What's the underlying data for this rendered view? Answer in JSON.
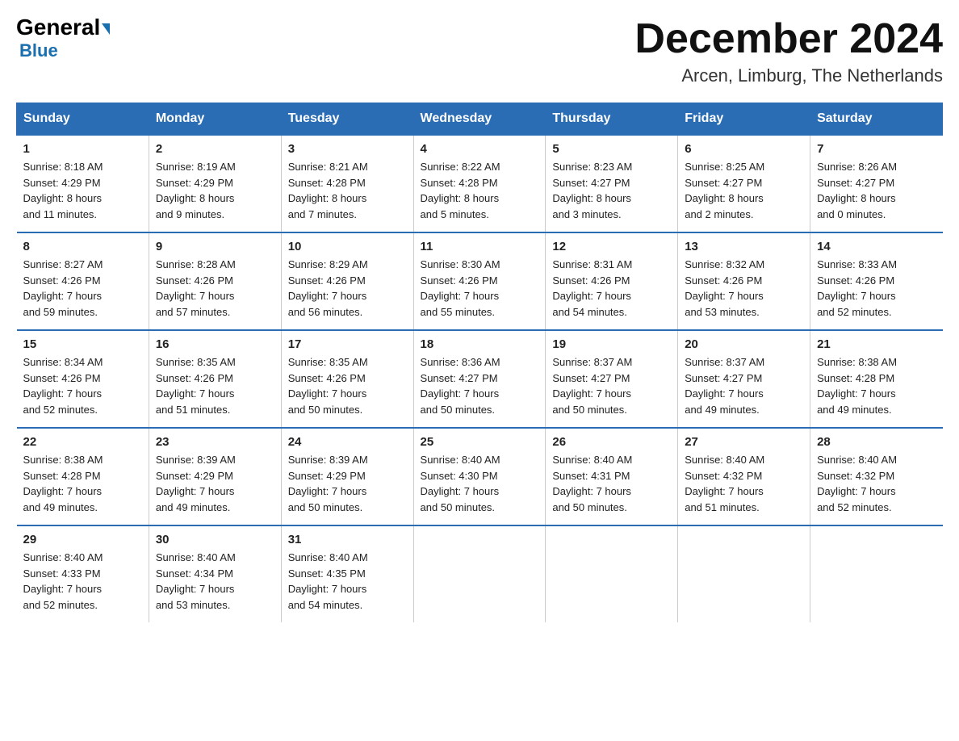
{
  "header": {
    "logo_line1": "General",
    "logo_line2": "Blue",
    "month_year": "December 2024",
    "location": "Arcen, Limburg, The Netherlands"
  },
  "days_of_week": [
    "Sunday",
    "Monday",
    "Tuesday",
    "Wednesday",
    "Thursday",
    "Friday",
    "Saturday"
  ],
  "weeks": [
    [
      {
        "num": "1",
        "info": "Sunrise: 8:18 AM\nSunset: 4:29 PM\nDaylight: 8 hours\nand 11 minutes."
      },
      {
        "num": "2",
        "info": "Sunrise: 8:19 AM\nSunset: 4:29 PM\nDaylight: 8 hours\nand 9 minutes."
      },
      {
        "num": "3",
        "info": "Sunrise: 8:21 AM\nSunset: 4:28 PM\nDaylight: 8 hours\nand 7 minutes."
      },
      {
        "num": "4",
        "info": "Sunrise: 8:22 AM\nSunset: 4:28 PM\nDaylight: 8 hours\nand 5 minutes."
      },
      {
        "num": "5",
        "info": "Sunrise: 8:23 AM\nSunset: 4:27 PM\nDaylight: 8 hours\nand 3 minutes."
      },
      {
        "num": "6",
        "info": "Sunrise: 8:25 AM\nSunset: 4:27 PM\nDaylight: 8 hours\nand 2 minutes."
      },
      {
        "num": "7",
        "info": "Sunrise: 8:26 AM\nSunset: 4:27 PM\nDaylight: 8 hours\nand 0 minutes."
      }
    ],
    [
      {
        "num": "8",
        "info": "Sunrise: 8:27 AM\nSunset: 4:26 PM\nDaylight: 7 hours\nand 59 minutes."
      },
      {
        "num": "9",
        "info": "Sunrise: 8:28 AM\nSunset: 4:26 PM\nDaylight: 7 hours\nand 57 minutes."
      },
      {
        "num": "10",
        "info": "Sunrise: 8:29 AM\nSunset: 4:26 PM\nDaylight: 7 hours\nand 56 minutes."
      },
      {
        "num": "11",
        "info": "Sunrise: 8:30 AM\nSunset: 4:26 PM\nDaylight: 7 hours\nand 55 minutes."
      },
      {
        "num": "12",
        "info": "Sunrise: 8:31 AM\nSunset: 4:26 PM\nDaylight: 7 hours\nand 54 minutes."
      },
      {
        "num": "13",
        "info": "Sunrise: 8:32 AM\nSunset: 4:26 PM\nDaylight: 7 hours\nand 53 minutes."
      },
      {
        "num": "14",
        "info": "Sunrise: 8:33 AM\nSunset: 4:26 PM\nDaylight: 7 hours\nand 52 minutes."
      }
    ],
    [
      {
        "num": "15",
        "info": "Sunrise: 8:34 AM\nSunset: 4:26 PM\nDaylight: 7 hours\nand 52 minutes."
      },
      {
        "num": "16",
        "info": "Sunrise: 8:35 AM\nSunset: 4:26 PM\nDaylight: 7 hours\nand 51 minutes."
      },
      {
        "num": "17",
        "info": "Sunrise: 8:35 AM\nSunset: 4:26 PM\nDaylight: 7 hours\nand 50 minutes."
      },
      {
        "num": "18",
        "info": "Sunrise: 8:36 AM\nSunset: 4:27 PM\nDaylight: 7 hours\nand 50 minutes."
      },
      {
        "num": "19",
        "info": "Sunrise: 8:37 AM\nSunset: 4:27 PM\nDaylight: 7 hours\nand 50 minutes."
      },
      {
        "num": "20",
        "info": "Sunrise: 8:37 AM\nSunset: 4:27 PM\nDaylight: 7 hours\nand 49 minutes."
      },
      {
        "num": "21",
        "info": "Sunrise: 8:38 AM\nSunset: 4:28 PM\nDaylight: 7 hours\nand 49 minutes."
      }
    ],
    [
      {
        "num": "22",
        "info": "Sunrise: 8:38 AM\nSunset: 4:28 PM\nDaylight: 7 hours\nand 49 minutes."
      },
      {
        "num": "23",
        "info": "Sunrise: 8:39 AM\nSunset: 4:29 PM\nDaylight: 7 hours\nand 49 minutes."
      },
      {
        "num": "24",
        "info": "Sunrise: 8:39 AM\nSunset: 4:29 PM\nDaylight: 7 hours\nand 50 minutes."
      },
      {
        "num": "25",
        "info": "Sunrise: 8:40 AM\nSunset: 4:30 PM\nDaylight: 7 hours\nand 50 minutes."
      },
      {
        "num": "26",
        "info": "Sunrise: 8:40 AM\nSunset: 4:31 PM\nDaylight: 7 hours\nand 50 minutes."
      },
      {
        "num": "27",
        "info": "Sunrise: 8:40 AM\nSunset: 4:32 PM\nDaylight: 7 hours\nand 51 minutes."
      },
      {
        "num": "28",
        "info": "Sunrise: 8:40 AM\nSunset: 4:32 PM\nDaylight: 7 hours\nand 52 minutes."
      }
    ],
    [
      {
        "num": "29",
        "info": "Sunrise: 8:40 AM\nSunset: 4:33 PM\nDaylight: 7 hours\nand 52 minutes."
      },
      {
        "num": "30",
        "info": "Sunrise: 8:40 AM\nSunset: 4:34 PM\nDaylight: 7 hours\nand 53 minutes."
      },
      {
        "num": "31",
        "info": "Sunrise: 8:40 AM\nSunset: 4:35 PM\nDaylight: 7 hours\nand 54 minutes."
      },
      {
        "num": "",
        "info": ""
      },
      {
        "num": "",
        "info": ""
      },
      {
        "num": "",
        "info": ""
      },
      {
        "num": "",
        "info": ""
      }
    ]
  ]
}
